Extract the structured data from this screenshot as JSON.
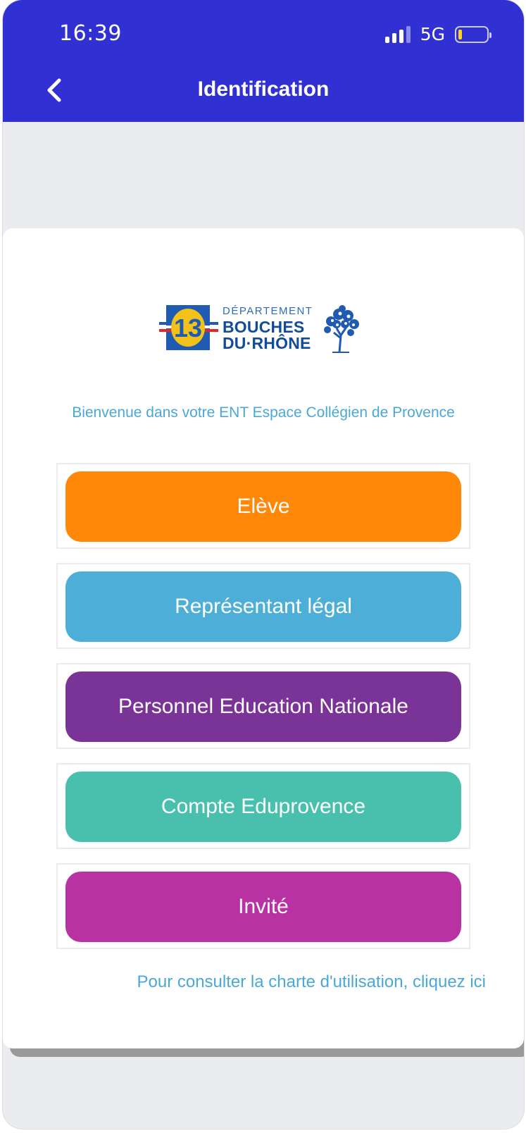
{
  "status_bar": {
    "time": "16:39",
    "network": "5G",
    "battery_level": 0.12
  },
  "header": {
    "title": "Identification",
    "back_icon": "chevron-left-icon",
    "background_color": "#3131d3"
  },
  "logo": {
    "badge_number": "13",
    "department_label": "DÉPARTEMENT",
    "line1": "BOUCHES",
    "line2": "DU·RHÔNE"
  },
  "welcome_text": "Bienvenue dans votre ENT Espace Collégien de Provence",
  "buttons": [
    {
      "label": "Elève",
      "color": "#ff8808"
    },
    {
      "label": "Représentant légal",
      "color": "#4dafd8"
    },
    {
      "label": "Personnel Education Nationale",
      "color": "#7a3396"
    },
    {
      "label": "Compte Eduprovence",
      "color": "#49c0ae"
    },
    {
      "label": "Invité",
      "color": "#b932a3"
    }
  ],
  "charte_link": "Pour consulter la charte d'utilisation, cliquez ici"
}
